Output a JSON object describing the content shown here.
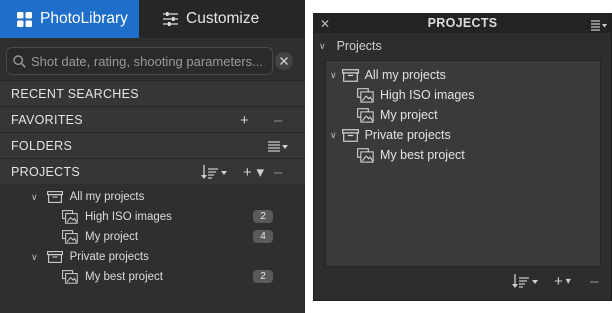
{
  "left_panel": {
    "tabs": [
      {
        "label": "PhotoLibrary",
        "icon": "grid-icon",
        "active": true
      },
      {
        "label": "Customize",
        "icon": "sliders-icon",
        "active": false
      }
    ],
    "search": {
      "placeholder": "Shot date, rating, shooting parameters..."
    },
    "sections": [
      {
        "label": "RECENT SEARCHES"
      },
      {
        "label": "FAVORITES",
        "actions": [
          "+",
          "–"
        ]
      },
      {
        "label": "FOLDERS",
        "actions": [
          "list-menu-icon"
        ]
      },
      {
        "label": "PROJECTS",
        "actions": [
          "sort-icon",
          "+ ▾",
          "–"
        ]
      }
    ],
    "tree": [
      {
        "label": "All my projects",
        "type": "group",
        "expanded": true
      },
      {
        "label": "High ISO images",
        "type": "project",
        "count": "2"
      },
      {
        "label": "My project",
        "type": "project",
        "count": "4"
      },
      {
        "label": "Private projects",
        "type": "group",
        "expanded": true
      },
      {
        "label": "My best project",
        "type": "project",
        "count": "2"
      }
    ]
  },
  "right_panel": {
    "title": "PROJECTS",
    "subheader": "Projects",
    "tree": [
      {
        "label": "All my projects",
        "type": "group",
        "expanded": true
      },
      {
        "label": "High ISO images",
        "type": "project"
      },
      {
        "label": "My project",
        "type": "project"
      },
      {
        "label": "Private projects",
        "type": "group",
        "expanded": true
      },
      {
        "label": "My best project",
        "type": "project"
      }
    ],
    "footer": {
      "add": "+",
      "remove": "–"
    }
  },
  "symbols": {
    "chevron": "∨",
    "plus": "+",
    "minus": "–",
    "dropdown": "▾",
    "close": "✕"
  },
  "colors": {
    "accent": "#1d6fc9",
    "panel": "#2f2f2f",
    "section": "#363636",
    "badge": "#5a5a5a"
  }
}
